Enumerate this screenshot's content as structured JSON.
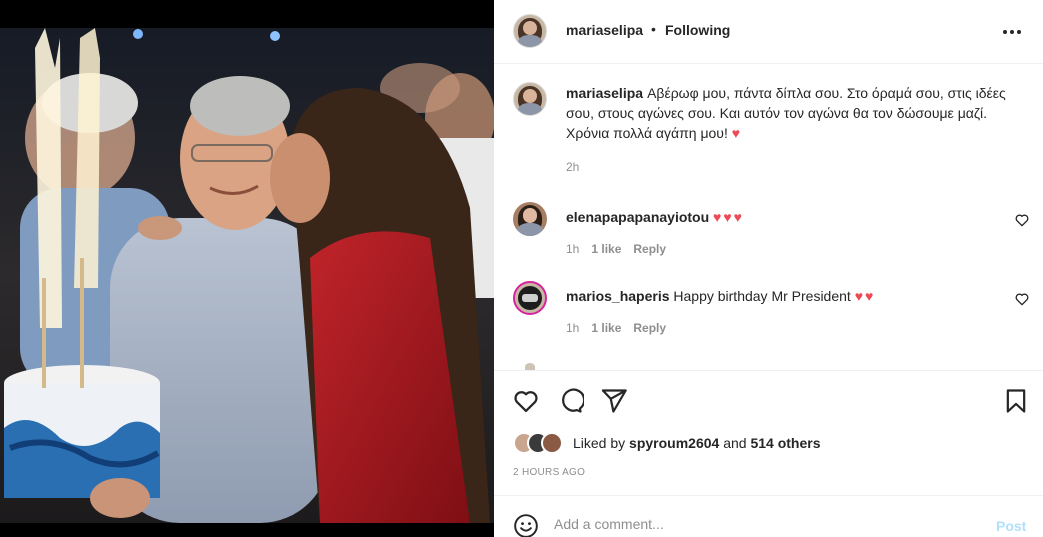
{
  "post": {
    "username": "mariaselipa",
    "follow_state": "Following",
    "caption": "Αβέρωφ μου, πάντα δίπλα σου. Στο όραμά σου, στις ιδέες σου, στους αγώνες σου. Και αυτόν τον αγώνα θα τον δώσουμε μαζί. Χρόνια πολλά αγάπη μου!",
    "caption_emoji": "♥",
    "caption_time": "2h"
  },
  "comments": [
    {
      "username": "elenapapapanayiotou",
      "text": "",
      "emoji": "♥♥♥",
      "time": "1h",
      "likes": "1 like",
      "reply": "Reply"
    },
    {
      "username": "marios_haperis",
      "text": "Happy birthday Mr President",
      "emoji": "♥♥",
      "time": "1h",
      "likes": "1 like",
      "reply": "Reply"
    }
  ],
  "likes": {
    "liked_by_prefix": "Liked by",
    "liked_by_user": "spyroum2604",
    "and": "and",
    "others": "514 others"
  },
  "timestamp": "2 HOURS AGO",
  "add_comment": {
    "placeholder": "Add a comment...",
    "post_label": "Post"
  },
  "icons": {
    "like": "heart-icon",
    "comment": "comment-icon",
    "share": "share-icon",
    "save": "bookmark-icon",
    "emoji": "emoji-icon",
    "more": "more-icon"
  },
  "colors": {
    "heart": "#ed4956",
    "post_button_disabled": "#b2dffc",
    "secondary_text": "#8e8e8e"
  }
}
